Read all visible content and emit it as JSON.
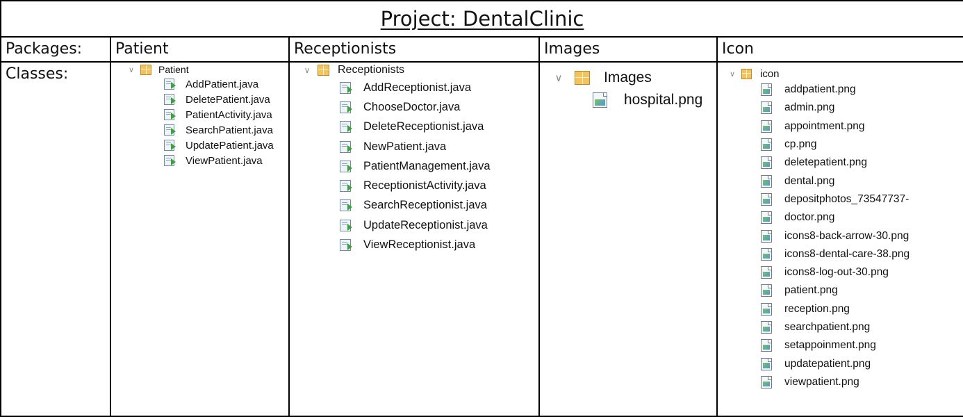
{
  "title": "Project: DentalClinic",
  "labels": {
    "packages": "Packages:",
    "classes": "Classes:"
  },
  "columns": [
    {
      "header": "Patient",
      "folder": "Patient",
      "file_kind": "java",
      "files": [
        "AddPatient.java",
        "DeletePatient.java",
        "PatientActivity.java",
        "SearchPatient.java",
        "UpdatePatient.java",
        "ViewPatient.java"
      ]
    },
    {
      "header": "Receptionists",
      "folder": "Receptionists",
      "file_kind": "java",
      "files": [
        "AddReceptionist.java",
        "ChooseDoctor.java",
        "DeleteReceptionist.java",
        "NewPatient.java",
        "PatientManagement.java",
        "ReceptionistActivity.java",
        "SearchReceptionist.java",
        "UpdateReceptionist.java",
        "ViewReceptionist.java"
      ]
    },
    {
      "header": "Images",
      "folder": "Images",
      "file_kind": "image",
      "files": [
        "hospital.png"
      ]
    },
    {
      "header": "Icon",
      "folder": "icon",
      "file_kind": "image",
      "files": [
        "addpatient.png",
        "admin.png",
        "appointment.png",
        "cp.png",
        "deletepatient.png",
        "dental.png",
        "depositphotos_73547737-",
        "doctor.png",
        "icons8-back-arrow-30.png",
        "icons8-dental-care-38.png",
        "icons8-log-out-30.png",
        "patient.png",
        "reception.png",
        "searchpatient.png",
        "setappoinment.png",
        "updatepatient.png",
        "viewpatient.png"
      ]
    }
  ],
  "icons": {
    "collapse": "chevron-down-icon",
    "package": "package-icon",
    "java": "java-file-icon",
    "image": "image-file-icon"
  },
  "colors": {
    "package": "#f3c35d",
    "java_arrow": "#3da23d",
    "border": "#000000"
  }
}
